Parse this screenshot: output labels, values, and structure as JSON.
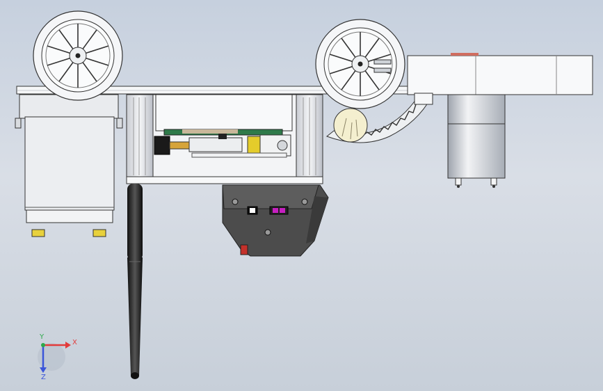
{
  "viewport": {
    "background_top": "#c6d0de",
    "background_bottom": "#c7cfd9"
  },
  "triad": {
    "x_label": "X",
    "y_label": "Y",
    "z_label": "Z",
    "x_color": "#e23b3b",
    "y_color": "#2ea84a",
    "z_color": "#3b55d9"
  },
  "parts": [
    "left-wheel",
    "right-wheel",
    "servo-motor",
    "top-plate",
    "chassis-frame",
    "circuit-board",
    "battery-box",
    "antenna",
    "gear-motor",
    "gear-rack-arm"
  ]
}
